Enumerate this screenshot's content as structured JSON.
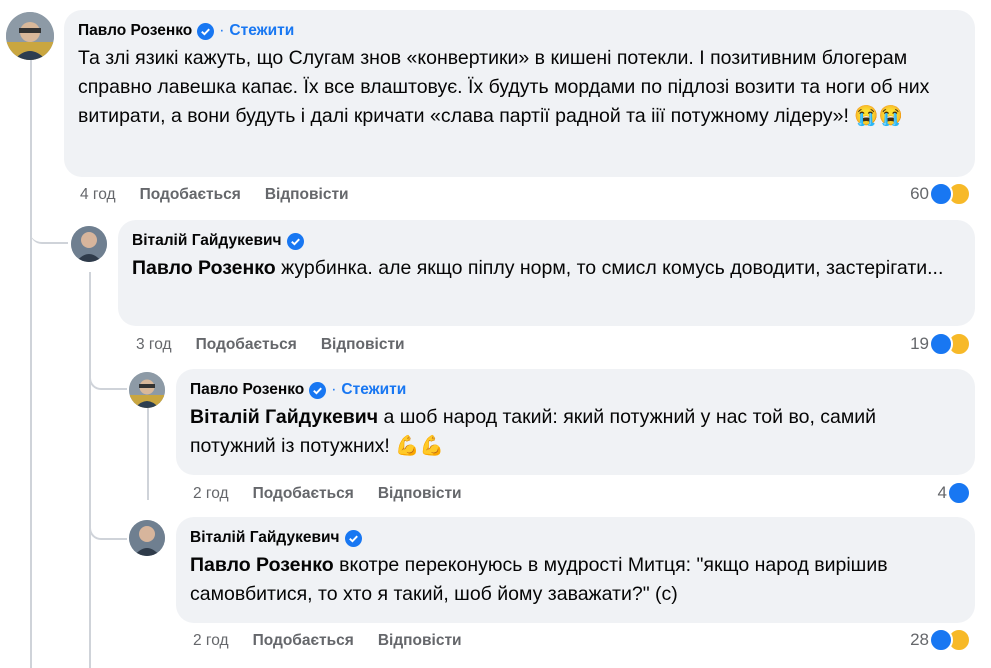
{
  "comments": [
    {
      "author": "Павло Розенко",
      "follow": "Стежити",
      "dot": "·",
      "text": "Та злі язикі кажуть, що Слугам знов «конвертики» в кишені потекли. І позитивним блогерам справно лавешка капає. Їх все влаштовує. Їх будуть мордами по підлозі возити та ноги об них витирати, а вони будуть і далі кричати «слава партії радной та іії потужному лідеру»! 😭😭",
      "time": "4 год",
      "like": "Подобається",
      "reply": "Відповісти",
      "reactions": "60"
    },
    {
      "author": "Віталій Гайдукевич",
      "mention": "Павло Розенко",
      "text": " журбинка. але якщо піплу норм, то смисл комусь доводити, застерігати...",
      "time": "3 год",
      "like": "Подобається",
      "reply": "Відповісти",
      "reactions": "19"
    },
    {
      "author": "Павло Розенко",
      "follow": "Стежити",
      "dot": "·",
      "mention": "Віталій Гайдукевич",
      "text": " а шоб народ такий: який потужний у нас той во, самий потужний із потужних! 💪💪",
      "time": "2 год",
      "like": "Подобається",
      "reply": "Відповісти",
      "reactions": "4"
    },
    {
      "author": "Віталій Гайдукевич",
      "mention": "Павло Розенко",
      "text": " вкотре переконуюсь в мудрості Митця: \"якщо народ вирішив самовбитися, то хто я такий, шоб йому заважати?\" (с)",
      "time": "2 год",
      "like": "Подобається",
      "reply": "Відповісти",
      "reactions": "28"
    }
  ],
  "icons": {
    "verified": "verified-badge-icon",
    "like": "like-reaction-icon",
    "sad": "sad-reaction-icon"
  },
  "colors": {
    "accent": "#1877f2",
    "bubble": "#f0f2f5",
    "meta": "#65676b",
    "sad": "#f7b928"
  }
}
